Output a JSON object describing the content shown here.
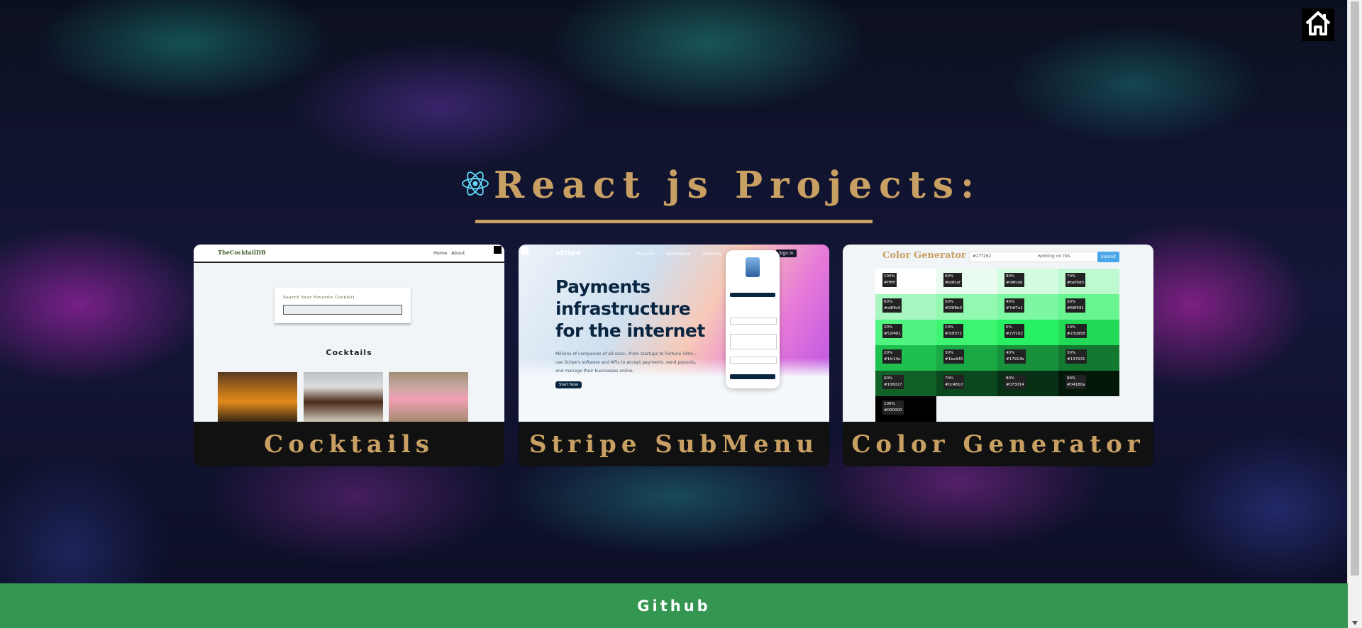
{
  "page": {
    "title": "React js Projects:",
    "title_icon": "react-atom-icon",
    "home_icon": "home-icon",
    "accent_color": "#c9a063"
  },
  "projects": [
    {
      "label": "Cocktails",
      "preview": {
        "brand": "TheCocktailDB",
        "nav_links": "Home About",
        "search_label": "Search Your Favorite Cocktail",
        "heading": "Cocktails"
      }
    },
    {
      "label": "Stripe SubMenu",
      "preview": {
        "logo": "stripe",
        "nav_links": "Products Developers Company",
        "signin": "Sign In",
        "headline": "Payments infrastructure for the internet",
        "paragraph": "Millions of companies of all sizes—from startups to Fortune 500s—use Stripe's software and APIs to accept payments, send payouts, and manage their businesses online.",
        "cta": "Start Now"
      }
    },
    {
      "label": "Color Generator",
      "preview": {
        "title": "Color Generator",
        "input_value": "#27f162",
        "input_hint": "working on this",
        "submit": "Submit",
        "swatches": [
          {
            "pct": "100%",
            "hex": "#ffffff",
            "color": "#ffffff"
          },
          {
            "pct": "90%",
            "hex": "#e9fcef",
            "color": "#e9fcef"
          },
          {
            "pct": "80%",
            "hex": "#d4fcdd",
            "color": "#d4fce0"
          },
          {
            "pct": "70%",
            "hex": "#bef9d0",
            "color": "#bef9d0"
          },
          {
            "pct": "60%",
            "hex": "#a9f9c0",
            "color": "#a9f7c0"
          },
          {
            "pct": "50%",
            "hex": "#93f8b0",
            "color": "#93f8b0"
          },
          {
            "pct": "40%",
            "hex": "#7df7a1",
            "color": "#7df7a1"
          },
          {
            "pct": "30%",
            "hex": "#68f591",
            "color": "#68f591"
          },
          {
            "pct": "20%",
            "hex": "#52f481",
            "color": "#52f481"
          },
          {
            "pct": "10%",
            "hex": "#3df372",
            "color": "#3df372"
          },
          {
            "pct": "0%",
            "hex": "#27f162",
            "color": "#27f162"
          },
          {
            "pct": "10%",
            "hex": "#23d958",
            "color": "#23d958"
          },
          {
            "pct": "20%",
            "hex": "#1fc14e",
            "color": "#1fc14e"
          },
          {
            "pct": "30%",
            "hex": "#1ba945",
            "color": "#1ba945"
          },
          {
            "pct": "40%",
            "hex": "#17913b",
            "color": "#17913b"
          },
          {
            "pct": "50%",
            "hex": "#137931",
            "color": "#137931"
          },
          {
            "pct": "60%",
            "hex": "#106027",
            "color": "#106027"
          },
          {
            "pct": "70%",
            "hex": "#0c481d",
            "color": "#0c481d"
          },
          {
            "pct": "80%",
            "hex": "#073014",
            "color": "#083014"
          },
          {
            "pct": "90%",
            "hex": "#04180a",
            "color": "#04180a"
          },
          {
            "pct": "100%",
            "hex": "#000000",
            "color": "#000000"
          }
        ]
      }
    }
  ],
  "footer": {
    "link": "Github",
    "color": "#349651"
  }
}
